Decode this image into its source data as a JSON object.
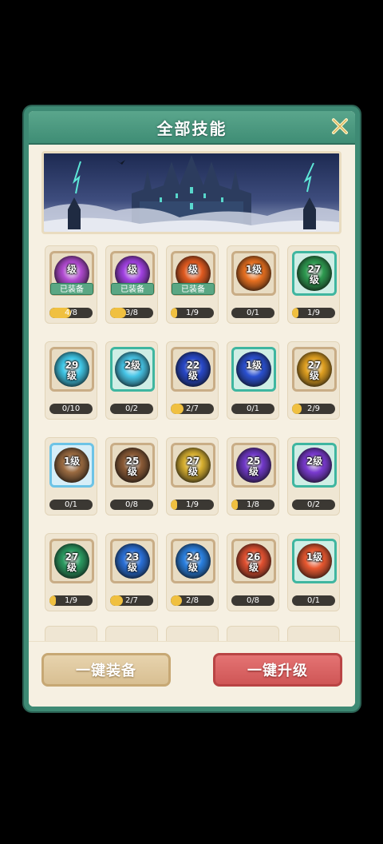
{
  "dialog": {
    "title": "全部技能",
    "equip_all_label": "一键装备",
    "upgrade_all_label": "一键升级"
  },
  "skills": [
    {
      "level": "级",
      "progress": "4/8",
      "equipped": "已装备",
      "fill": 0.5,
      "frame": "normal",
      "color": "#b04ad0"
    },
    {
      "level": "级",
      "progress": "3/8",
      "equipped": "已装备",
      "fill": 0.375,
      "frame": "normal",
      "color": "#a040e0"
    },
    {
      "level": "级",
      "progress": "1/9",
      "equipped": "已装备",
      "fill": 0.11,
      "frame": "normal",
      "color": "#e05a20"
    },
    {
      "level": "1级",
      "progress": "0/1",
      "equipped": "",
      "fill": 0,
      "frame": "normal",
      "color": "#e87020"
    },
    {
      "level": "27\n级",
      "progress": "1/9",
      "equipped": "",
      "fill": 0.11,
      "frame": "teal",
      "color": "#2e9a50"
    },
    {
      "level": "29\n级",
      "progress": "0/10",
      "equipped": "",
      "fill": 0,
      "frame": "normal",
      "color": "#40c8e8"
    },
    {
      "level": "2级",
      "progress": "0/2",
      "equipped": "",
      "fill": 0,
      "frame": "teal",
      "color": "#46c4e6"
    },
    {
      "level": "22\n级",
      "progress": "2/7",
      "equipped": "",
      "fill": 0.29,
      "frame": "normal",
      "color": "#2848c8"
    },
    {
      "level": "1级",
      "progress": "0/1",
      "equipped": "",
      "fill": 0,
      "frame": "teal",
      "color": "#2a50d0"
    },
    {
      "level": "27\n级",
      "progress": "2/9",
      "equipped": "",
      "fill": 0.22,
      "frame": "normal",
      "color": "#e0a020"
    },
    {
      "level": "1级",
      "progress": "0/1",
      "equipped": "",
      "fill": 0,
      "frame": "blue",
      "color": "#9a6a40"
    },
    {
      "level": "25\n级",
      "progress": "0/8",
      "equipped": "",
      "fill": 0,
      "frame": "normal",
      "color": "#8a5a36"
    },
    {
      "level": "27\n级",
      "progress": "1/9",
      "equipped": "",
      "fill": 0.11,
      "frame": "normal",
      "color": "#d8b030"
    },
    {
      "level": "25\n级",
      "progress": "1/8",
      "equipped": "",
      "fill": 0.125,
      "frame": "normal",
      "color": "#7038c8"
    },
    {
      "level": "2级",
      "progress": "0/2",
      "equipped": "",
      "fill": 0,
      "frame": "teal",
      "color": "#7a3ad0"
    },
    {
      "level": "27\n级",
      "progress": "1/9",
      "equipped": "",
      "fill": 0.11,
      "frame": "normal",
      "color": "#2a9a60"
    },
    {
      "level": "23\n级",
      "progress": "2/7",
      "equipped": "",
      "fill": 0.29,
      "frame": "normal",
      "color": "#2a70d8"
    },
    {
      "level": "24\n级",
      "progress": "2/8",
      "equipped": "",
      "fill": 0.25,
      "frame": "normal",
      "color": "#2a80e0"
    },
    {
      "level": "26\n级",
      "progress": "0/8",
      "equipped": "",
      "fill": 0,
      "frame": "normal",
      "color": "#e05030"
    },
    {
      "level": "1级",
      "progress": "0/1",
      "equipped": "",
      "fill": 0,
      "frame": "teal",
      "color": "#e85830"
    }
  ]
}
